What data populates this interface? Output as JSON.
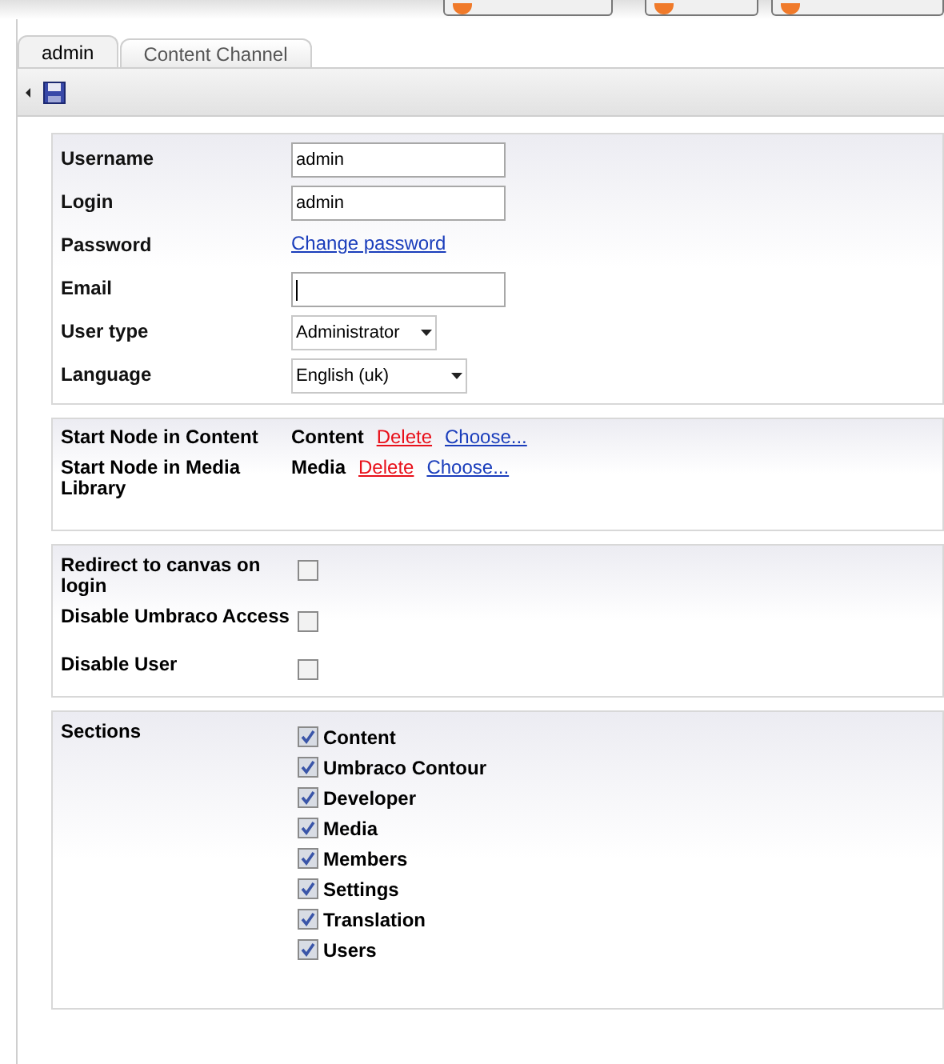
{
  "top_buttons": [
    {
      "kind": "action"
    },
    {
      "kind": "action"
    },
    {
      "kind": "action"
    }
  ],
  "tabs": [
    {
      "label": "admin",
      "selected": true
    },
    {
      "label": "Content Channel",
      "selected": false
    }
  ],
  "details": [
    {
      "label": "Username",
      "kind": "text",
      "value": "admin"
    },
    {
      "label": "Login",
      "kind": "text",
      "value": "admin"
    },
    {
      "label": "Password",
      "kind": "link",
      "value": "Change password"
    },
    {
      "label": "Email",
      "kind": "text",
      "focused": true
    },
    {
      "label": "User type",
      "kind": "select",
      "value": "Administrator"
    },
    {
      "label": "Language",
      "kind": "select",
      "value": "English (uk)"
    }
  ],
  "start_nodes": [
    {
      "label": "Start Node in Content",
      "node": "Content",
      "delete": "Delete",
      "choose": "Choose..."
    },
    {
      "label": "Start Node in Media Library",
      "node": "Media",
      "delete": "Delete",
      "choose": "Choose..."
    }
  ],
  "options": [
    {
      "label": "Redirect to canvas on login",
      "checked": false
    },
    {
      "label": "Disable Umbraco Access",
      "checked": false
    },
    {
      "label": "Disable User",
      "checked": false
    }
  ],
  "sections": {
    "label": "Sections",
    "items": [
      {
        "label": "Content",
        "checked": true
      },
      {
        "label": "Umbraco Contour",
        "checked": true
      },
      {
        "label": "Developer",
        "checked": true
      },
      {
        "label": "Media",
        "checked": true
      },
      {
        "label": "Members",
        "checked": true
      },
      {
        "label": "Settings",
        "checked": true
      },
      {
        "label": "Translation",
        "checked": true
      },
      {
        "label": "Users",
        "checked": true
      }
    ]
  }
}
